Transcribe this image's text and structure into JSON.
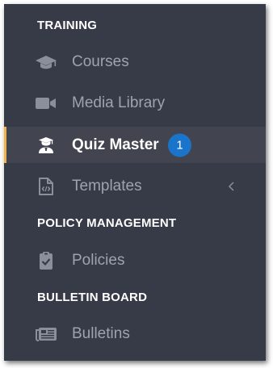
{
  "sidebar": {
    "sections": [
      {
        "title": "TRAINING",
        "items": [
          {
            "label": "Courses",
            "icon": "graduation-cap-icon"
          },
          {
            "label": "Media Library",
            "icon": "video-camera-icon"
          },
          {
            "label": "Quiz Master",
            "icon": "user-graduate-icon",
            "active": true,
            "badge": "1"
          },
          {
            "label": "Templates",
            "icon": "file-code-icon",
            "submenu_icon": "chevron-left-icon"
          }
        ]
      },
      {
        "title": "POLICY MANAGEMENT",
        "items": [
          {
            "label": "Policies",
            "icon": "clipboard-check-icon"
          }
        ]
      },
      {
        "title": "BULLETIN BOARD",
        "items": [
          {
            "label": "Bulletins",
            "icon": "newspaper-icon"
          }
        ]
      }
    ]
  },
  "colors": {
    "sidebar_bg": "#373a47",
    "active_item_bg": "#42454f",
    "active_indicator": "#f1b44c",
    "badge_bg": "#1a74c9",
    "label_muted": "#9ea3ae",
    "icon_muted": "#8a8f9b",
    "text_white": "#ffffff"
  }
}
